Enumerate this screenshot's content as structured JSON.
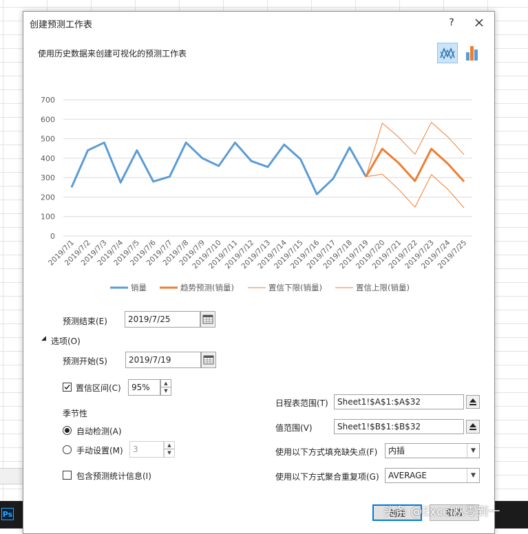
{
  "dialog": {
    "title": "创建预测工作表",
    "help_label": "?",
    "subtitle": "使用历史数据来创建可视化的预测工作表"
  },
  "chart_data": {
    "type": "line",
    "categories": [
      "2019/7/1",
      "2019/7/2",
      "2019/7/3",
      "2019/7/4",
      "2019/7/5",
      "2019/7/6",
      "2019/7/7",
      "2019/7/8",
      "2019/7/9",
      "2019/7/10",
      "2019/7/11",
      "2019/7/12",
      "2019/7/13",
      "2019/7/14",
      "2019/7/15",
      "2019/7/16",
      "2019/7/17",
      "2019/7/18",
      "2019/7/19",
      "2019/7/20",
      "2019/7/21",
      "2019/7/22",
      "2019/7/23",
      "2019/7/24",
      "2019/7/25"
    ],
    "ylim": [
      0,
      700
    ],
    "yticks": [
      "0",
      "100",
      "200",
      "300",
      "400",
      "500",
      "600",
      "700"
    ],
    "grid": true,
    "legend_position": "bottom",
    "series": [
      {
        "name": "销量",
        "color": "#5b9bd5",
        "width": 3,
        "values": [
          250,
          440,
          480,
          275,
          440,
          280,
          305,
          480,
          400,
          360,
          480,
          385,
          355,
          470,
          395,
          215,
          295,
          455,
          305,
          null,
          null,
          null,
          null,
          null,
          null
        ]
      },
      {
        "name": "趋势预测(销量)",
        "color": "#ed7d31",
        "width": 3,
        "values": [
          null,
          null,
          null,
          null,
          null,
          null,
          null,
          null,
          null,
          null,
          null,
          null,
          null,
          null,
          null,
          null,
          null,
          null,
          305,
          448,
          375,
          283,
          448,
          372,
          280
        ]
      },
      {
        "name": "置信下限(销量)",
        "color": "#ed7d31",
        "width": 1,
        "values": [
          null,
          null,
          null,
          null,
          null,
          null,
          null,
          null,
          null,
          null,
          null,
          null,
          null,
          null,
          null,
          null,
          null,
          null,
          305,
          318,
          240,
          148,
          316,
          240,
          145
        ]
      },
      {
        "name": "置信上限(销量)",
        "color": "#ed7d31",
        "width": 1,
        "values": [
          null,
          null,
          null,
          null,
          null,
          null,
          null,
          null,
          null,
          null,
          null,
          null,
          null,
          null,
          null,
          null,
          null,
          null,
          305,
          580,
          508,
          420,
          584,
          510,
          418
        ]
      }
    ]
  },
  "form": {
    "forecast_end_label": "预测结束(E)",
    "forecast_end_value": "2019/7/25",
    "options_label": "选项(O)",
    "forecast_start_label": "预测开始(S)",
    "forecast_start_value": "2019/7/19",
    "confidence_label": "置信区间(C)",
    "confidence_value": "95%",
    "confidence_checked": true,
    "seasonality_label": "季节性",
    "auto_detect_label": "自动检测(A)",
    "manual_label": "手动设置(M)",
    "manual_value": "3",
    "include_stats_label": "包含预测统计信息(I)",
    "timeline_label": "日程表范围(T)",
    "timeline_value": "Sheet1!$A$1:$A$32",
    "values_label": "值范围(V)",
    "values_value": "Sheet1!$B$1:$B$32",
    "fill_missing_label": "使用以下方式填充缺失点(F)",
    "fill_missing_value": "内插",
    "aggregate_label": "使用以下方式聚合重复项(G)",
    "aggregate_value": "AVERAGE",
    "create_button": "创建",
    "cancel_button": "取消"
  },
  "watermark": "头条 @Excel从零到一",
  "taskbar": {
    "ps_label": "Ps"
  },
  "colors": {
    "accent": "#0078d7",
    "sales": "#5b9bd5",
    "forecast": "#ed7d31"
  }
}
